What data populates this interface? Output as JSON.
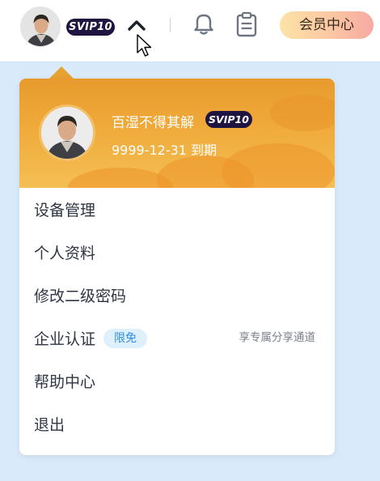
{
  "topbar": {
    "avatar_icon": "user-avatar",
    "svip_badge": "SVIP10",
    "dropdown_toggle_icon": "chevron-up-icon",
    "bell_icon": "bell-icon",
    "clipboard_icon": "clipboard-icon",
    "vip_center_label": "会员中心",
    "vip_center_gradient": [
      "#fde3a6",
      "#f7a9a3"
    ]
  },
  "profile": {
    "username": "百湿不得其解",
    "svip_badge": "SVIP10",
    "expiry": "9999-12-31 到期",
    "header_color": "#efaa3a"
  },
  "menu": {
    "items": [
      {
        "label": "设备管理"
      },
      {
        "label": "个人资料"
      },
      {
        "label": "修改二级密码"
      },
      {
        "label": "企业认证",
        "tag": "限免",
        "note": "享专属分享通道"
      },
      {
        "label": "帮助中心"
      },
      {
        "label": "退出"
      }
    ]
  },
  "colors": {
    "page_background": "#d9ebfb",
    "badge_dark": "#1f1540",
    "tag_blue": "#2f8fe6"
  }
}
